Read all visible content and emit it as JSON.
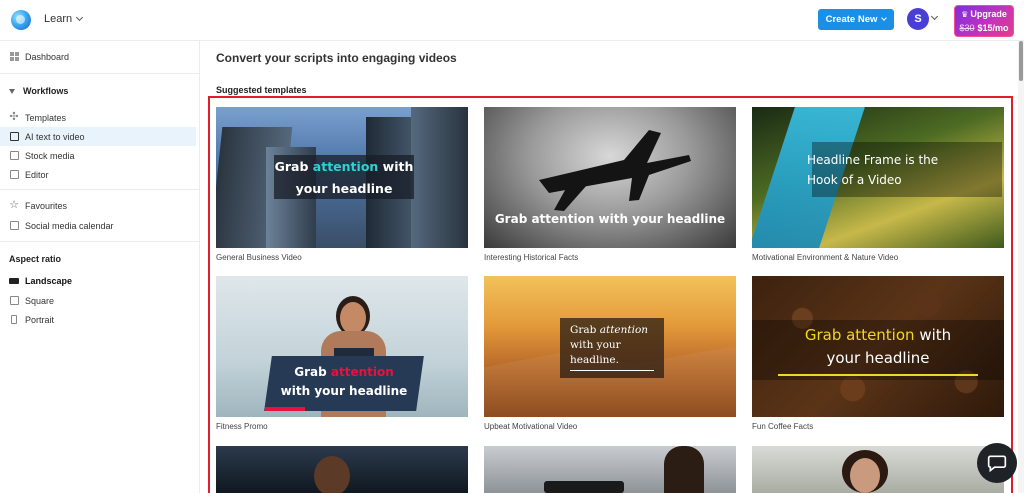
{
  "header": {
    "learn_label": "Learn",
    "create_label": "Create New",
    "avatar_initial": "S",
    "upgrade_label": "Upgrade",
    "old_price": "$30",
    "new_price": "$15/mo"
  },
  "sidebar": {
    "dashboard": "Dashboard",
    "workflows_heading": "Workflows",
    "workflow_items": [
      "Templates",
      "AI text to video",
      "Stock media",
      "Editor"
    ],
    "favourites": "Favourites",
    "social_calendar": "Social media calendar",
    "aspect_heading": "Aspect ratio",
    "aspect_items": [
      "Landscape",
      "Square",
      "Portrait"
    ]
  },
  "main": {
    "page_title": "Convert your scripts into engaging videos",
    "section_title": "Suggested templates",
    "cards": [
      {
        "label": "General Business Video",
        "line1a": "Grab ",
        "line1b": "attention",
        "line1c": " with",
        "line2": "your headline"
      },
      {
        "label": "Interesting Historical Facts",
        "line1": "Grab attention with your headline"
      },
      {
        "label": "Motivational Environment & Nature Video",
        "line1": "Headline Frame is the",
        "line2": "Hook of a Video"
      },
      {
        "label": "Fitness Promo",
        "line1a": "Grab ",
        "line1b": "attention",
        "line2": "with your headline"
      },
      {
        "label": "Upbeat Motivational Video",
        "line1a": "Grab ",
        "line1b": "attention",
        "line2": "with your",
        "line3": "headline."
      },
      {
        "label": "Fun Coffee Facts",
        "line1a": "Grab attention",
        "line1b": " with",
        "line2": "your headline"
      }
    ]
  },
  "colors": {
    "accent": "#1a8fe8",
    "highlight_border": "#e01e2b",
    "teal_word": "#2ad4d0",
    "red_word": "#e8123c",
    "yellow_word": "#f0d820"
  }
}
